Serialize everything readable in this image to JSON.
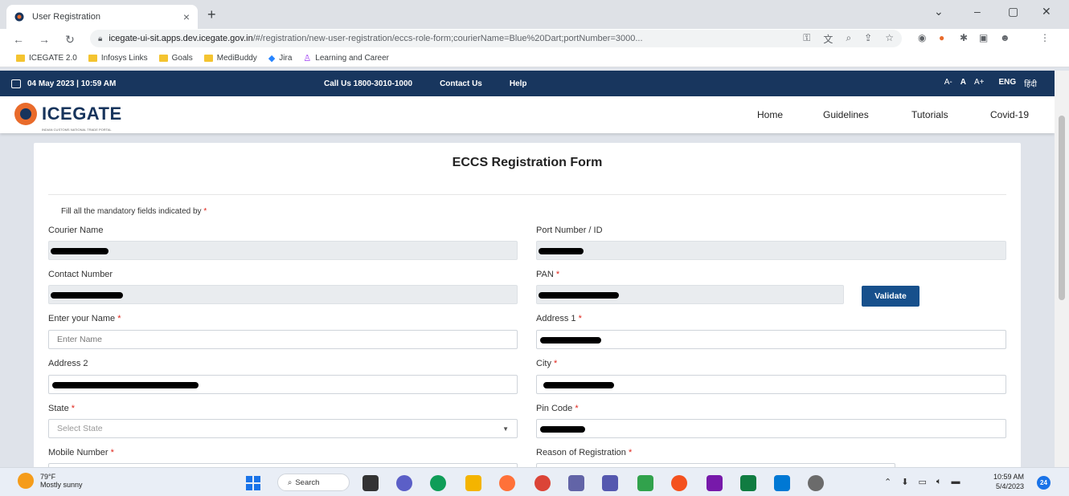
{
  "browser": {
    "tab_title": "User Registration",
    "url_host": "icegate-ui-sit.apps.dev.icegate.gov.in",
    "url_path": "/#/registration/new-user-registration/eccs-role-form;courierName=Blue%20Dart;portNumber=3000...",
    "bookmarks": [
      "ICEGATE 2.0",
      "Infosys Links",
      "Goals",
      "MediBuddy",
      "Jira",
      "Learning and Career"
    ]
  },
  "site": {
    "date_time": "04 May 2023 | 10:59 AM",
    "call_us": "Call Us  1800-3010-1000",
    "contact_us": "Contact Us",
    "help": "Help",
    "font_small": "A-",
    "font_normal": "A",
    "font_large": "A+",
    "lang_en": "ENG",
    "lang_hi": "हिंदी",
    "logo_text_a": "ICE",
    "logo_text_b": "GATE",
    "logo_tagline": "INDIAN CUSTOMS NATIONAL TRADE PORTAL",
    "nav": [
      "Home",
      "Guidelines",
      "Tutorials",
      "Covid-19"
    ]
  },
  "form": {
    "title": "ECCS Registration Form",
    "note": "Fill all the mandatory fields indicated by",
    "required_mark": "*",
    "courier_name_label": "Courier Name",
    "port_number_label": "Port Number / ID",
    "contact_number_label": "Contact Number",
    "pan_label": "PAN",
    "validate_button": "Validate",
    "name_label": "Enter your Name",
    "name_placeholder": "Enter Name",
    "address1_label": "Address 1",
    "address2_label": "Address 2",
    "city_label": "City",
    "state_label": "State",
    "state_placeholder": "Select State",
    "pin_code_label": "Pin Code",
    "mobile_label": "Mobile Number",
    "reason_label": "Reason of Registration"
  },
  "taskbar": {
    "temperature": "79°F",
    "weather": "Mostly sunny",
    "search": "Search",
    "time": "10:59 AM",
    "date": "5/4/2023",
    "notifications": "24"
  },
  "colors": {
    "header_bg": "#18365e",
    "accent_orange": "#e96b2b",
    "button_blue": "#17508c",
    "required_red": "#e0261c"
  }
}
